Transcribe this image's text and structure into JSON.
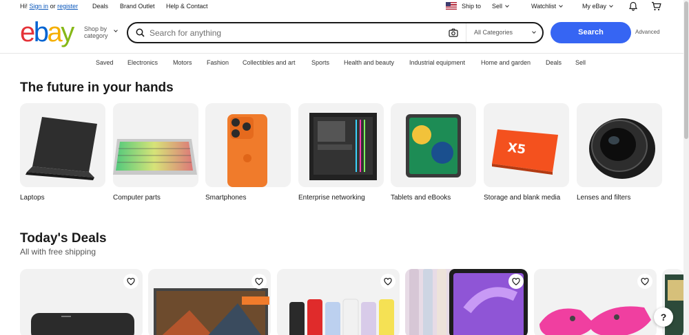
{
  "topbar": {
    "greeting": "Hi!",
    "sign_in": "Sign in",
    "or": "or",
    "register": "register",
    "deals": "Deals",
    "brand_outlet": "Brand Outlet",
    "help": "Help & Contact",
    "ship_to": "Ship to",
    "sell": "Sell",
    "watchlist": "Watchlist",
    "my_ebay": "My eBay"
  },
  "header": {
    "logo_letters": [
      "e",
      "b",
      "a",
      "y"
    ],
    "shop_by_1": "Shop by",
    "shop_by_2": "category",
    "search_placeholder": "Search for anything",
    "category_select": "All Categories",
    "search_button": "Search",
    "advanced": "Advanced"
  },
  "nav": [
    "Saved",
    "Electronics",
    "Motors",
    "Fashion",
    "Collectibles and art",
    "Sports",
    "Health and beauty",
    "Industrial equipment",
    "Home and garden",
    "Deals",
    "Sell"
  ],
  "future": {
    "title": "The future in your hands",
    "cards": [
      "Laptops",
      "Computer parts",
      "Smartphones",
      "Enterprise networking",
      "Tablets and eBooks",
      "Storage and blank media",
      "Lenses and filters"
    ]
  },
  "deals": {
    "title": "Today's Deals",
    "subtitle": "All with free shipping"
  },
  "help_button": "?",
  "colors": {
    "accent": "#3665f3",
    "link": "#0654ba",
    "logo_red": "#e53238",
    "logo_blue": "#0064d2",
    "logo_yellow": "#f5af02",
    "logo_green": "#86b817"
  }
}
